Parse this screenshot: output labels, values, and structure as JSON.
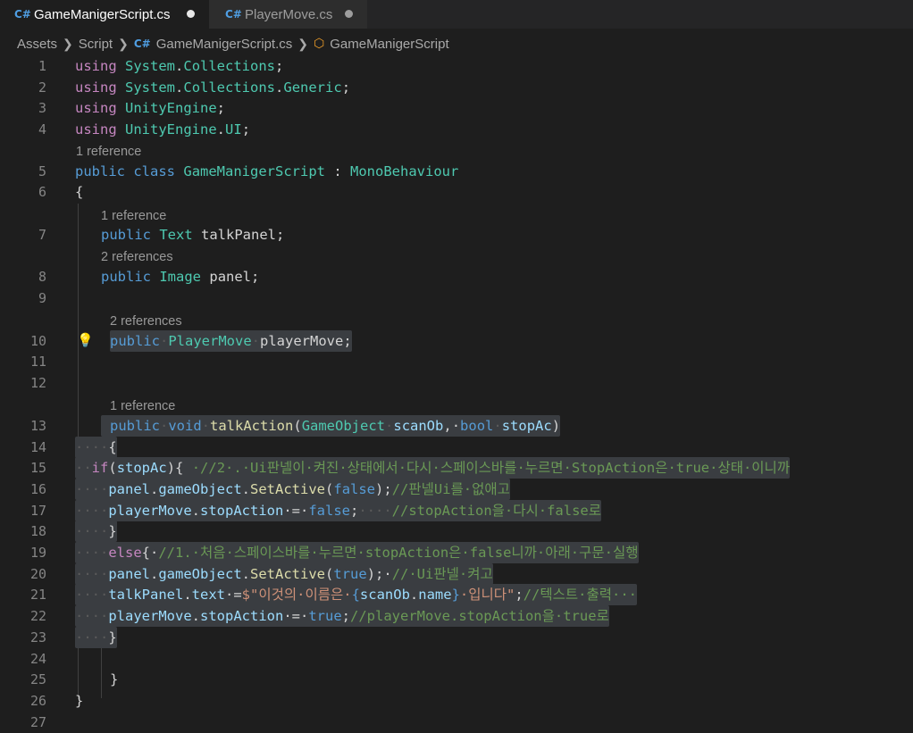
{
  "tabs": [
    {
      "label": "GameManigerScript.cs",
      "icon": "csharp-file-icon",
      "dirty": true
    },
    {
      "label": "PlayerMove.cs",
      "icon": "csharp-file-icon",
      "dirty": true
    }
  ],
  "breadcrumb": [
    "Assets",
    "Script",
    "GameManigerScript.cs",
    "GameManigerScript"
  ],
  "codelens": {
    "c5": "1 reference",
    "c7": "1 reference",
    "c8": "2 references",
    "c10": "2 references",
    "c13": "1 reference"
  },
  "line_numbers": [
    "1",
    "2",
    "3",
    "4",
    "5",
    "6",
    "7",
    "8",
    "9",
    "10",
    "11",
    "12",
    "13",
    "14",
    "15",
    "16",
    "17",
    "18",
    "19",
    "20",
    "21",
    "22",
    "23",
    "24",
    "25",
    "26",
    "27"
  ],
  "code": {
    "l1": [
      "using",
      " ",
      "System",
      ".",
      "Collections",
      ";"
    ],
    "l2": [
      "using",
      " ",
      "System",
      ".",
      "Collections",
      ".",
      "Generic",
      ";"
    ],
    "l3": [
      "using",
      " ",
      "UnityEngine",
      ";"
    ],
    "l4": [
      "using",
      " ",
      "UnityEngine",
      ".",
      "UI",
      ";"
    ],
    "l5": [
      "public",
      " ",
      "class",
      " ",
      "GameManigerScript",
      " : ",
      "MonoBehaviour"
    ],
    "l6": [
      "{"
    ],
    "l7": [
      "public",
      " ",
      "Text",
      " ",
      "talkPanel;"
    ],
    "l8": [
      "public",
      " ",
      "Image",
      " ",
      "panel;"
    ],
    "l10": [
      "public",
      "·",
      "PlayerMove",
      "·",
      "playerMove;"
    ],
    "l13": [
      "public",
      "·",
      "void",
      "·",
      "talkAction",
      "(",
      "GameObject",
      "·",
      "scanOb",
      ",·",
      "bool",
      "·",
      "stopAc",
      ")"
    ],
    "l14": [
      "····",
      "{"
    ],
    "l15": [
      "··",
      "if",
      "(",
      "stopAc",
      "){",
      " ",
      "·//2·.·Ui판넬이·켜진·상태에서·다시·스페이스바를·누르면·StopAction은·true·상태·이니까"
    ],
    "l16": [
      "····",
      "panel",
      ".",
      "gameObject",
      ".",
      "SetActive",
      "(",
      "false",
      ");",
      "//판넬Ui를·없애고"
    ],
    "l17": [
      "····",
      "playerMove",
      ".",
      "stopAction",
      "·=·",
      "false",
      ";",
      "····",
      "//stopAction을·다시·false로"
    ],
    "l18": [
      "····",
      "}"
    ],
    "l19": [
      "····",
      "else",
      "{·",
      "//1.·처음·스페이스바를·누르면·stopAction은·false니까·아래·구문·실행"
    ],
    "l20": [
      "····",
      "panel",
      ".",
      "gameObject",
      ".",
      "SetActive",
      "(",
      "true",
      ");·",
      "//·Ui판넬·켜고"
    ],
    "l21": [
      "····",
      "talkPanel",
      ".",
      "text",
      "·=",
      "$\"이것의·이름은·",
      "{",
      "scanOb",
      ".",
      "name",
      "}",
      "·입니다\"",
      ";",
      "//텍스트·출력···"
    ],
    "l22": [
      "····",
      "playerMove",
      ".",
      "stopAction",
      "·=·",
      "true",
      ";",
      "//playerMove.stopAction을·true로"
    ],
    "l23": [
      "····",
      "}"
    ],
    "l25": [
      "}"
    ],
    "l26": [
      "}"
    ]
  },
  "colors": {
    "background": "#1e1e1e",
    "keyword": "#569cd6",
    "directive": "#c586c0",
    "type": "#4ec9b0",
    "method": "#dcdcaa",
    "variable": "#9cdcfe",
    "comment": "#6a9955",
    "string": "#ce9178",
    "selection": "#3a3d41"
  }
}
